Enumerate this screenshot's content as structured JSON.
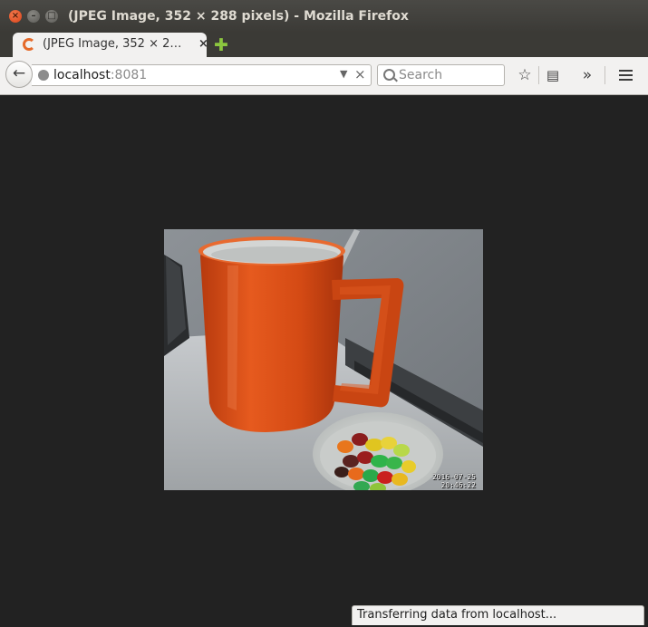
{
  "window": {
    "title": "(JPEG Image, 352 × 288 pixels) - Mozilla Firefox",
    "close_symbol": "×",
    "minimize_symbol": "–",
    "maximize_symbol": "□"
  },
  "tab": {
    "title": "(JPEG Image, 352 × 2…",
    "close_symbol": "×",
    "favicon": "firefox-icon",
    "new_tab_symbol": "✚"
  },
  "navbar": {
    "url_host": "localhost",
    "url_port": ":8081",
    "url_dropdown_symbol": "▼",
    "url_clear_symbol": "×",
    "search_placeholder": "Search",
    "back_symbol": "←",
    "bookmark_symbol": "☆",
    "reading_symbol": "▤",
    "overflow_symbol": "»"
  },
  "image": {
    "timestamp_date": "2016-07-25",
    "timestamp_time": "20:46:22"
  },
  "status": {
    "text": "Transferring data from localhost..."
  },
  "colors": {
    "content_background": "#222222",
    "mug": "#d84a14",
    "titlebar": "#3b3a36"
  }
}
